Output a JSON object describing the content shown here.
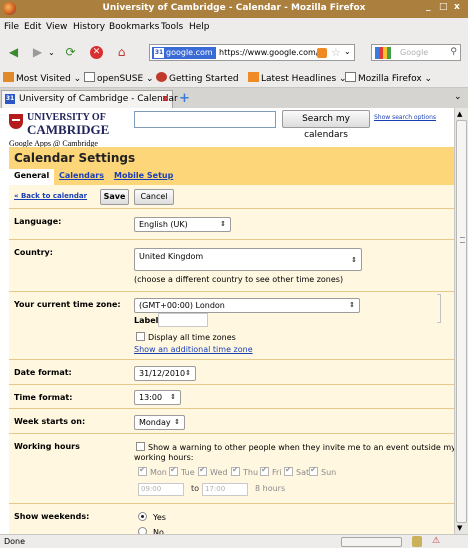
{
  "window": {
    "title": "University of Cambridge - Calendar - Mozilla Firefox",
    "controls": {
      "minimize": "_",
      "maximize": "□",
      "close": "x"
    }
  },
  "menu": [
    "File",
    "Edit",
    "View",
    "History",
    "Bookmarks",
    "Tools",
    "Help"
  ],
  "navbar": {
    "back": "◀",
    "forward": "▶",
    "reload": "⟳",
    "stop": "✕",
    "home": "⌂",
    "site_badge": "google.com",
    "url": "https://www.google.com/calen",
    "star": "☆",
    "dropdown": "⌄",
    "search_placeholder": "Google",
    "search_icon": "⚲"
  },
  "bookmarks": [
    "Most Visited ⌄",
    "openSUSE ⌄",
    "Getting Started",
    "Latest Headlines ⌄",
    "Mozilla Firefox ⌄"
  ],
  "tab": {
    "label": "University of Cambridge - Calendar",
    "favicon": "31",
    "close": "x",
    "new": "+"
  },
  "page": {
    "logo": {
      "line1": "UNIVERSITY OF",
      "line2": "CAMBRIDGE",
      "apps": "Google Apps @ Cambridge"
    },
    "search": {
      "value": "",
      "button": "Search my calendars",
      "options": "Show search options"
    },
    "settings_title": "Calendar Settings",
    "subtabs": [
      "General",
      "Calendars",
      "Mobile Setup"
    ],
    "back_link": "« Back to calendar",
    "save": "Save",
    "cancel": "Cancel",
    "language": {
      "label": "Language:",
      "value": "English (UK)"
    },
    "country": {
      "label": "Country:",
      "value": "United Kingdom",
      "note": "(choose a different country to see other time zones)"
    },
    "timezone": {
      "label": "Your current time zone:",
      "value": "(GMT+00:00) London",
      "label_field": "Label:",
      "display_all": "Display all time zones",
      "additional": "Show an additional time zone"
    },
    "date_format": {
      "label": "Date format:",
      "value": "31/12/2010"
    },
    "time_format": {
      "label": "Time format:",
      "value": "13:00"
    },
    "week_start": {
      "label": "Week starts on:",
      "value": "Monday"
    },
    "working_hours": {
      "label": "Working hours",
      "warning_line1": "Show a warning to other people when they invite me to an event outside my",
      "warning_line2": "working hours:",
      "days": [
        "Mon",
        "Tue",
        "Wed",
        "Thu",
        "Fri",
        "Sat",
        "Sun"
      ],
      "from": "09:00",
      "to_label": "to",
      "to": "17:00",
      "hours": "8 hours"
    },
    "weekends": {
      "label": "Show weekends:",
      "yes": "Yes",
      "no": "No",
      "selected": "Yes"
    }
  },
  "status": {
    "text": "Done"
  },
  "colors": {
    "titlebar": "#ab7f3d",
    "settings_header": "#fdd67a",
    "form_bg": "#fff7e0",
    "link": "#1a3fb5"
  }
}
